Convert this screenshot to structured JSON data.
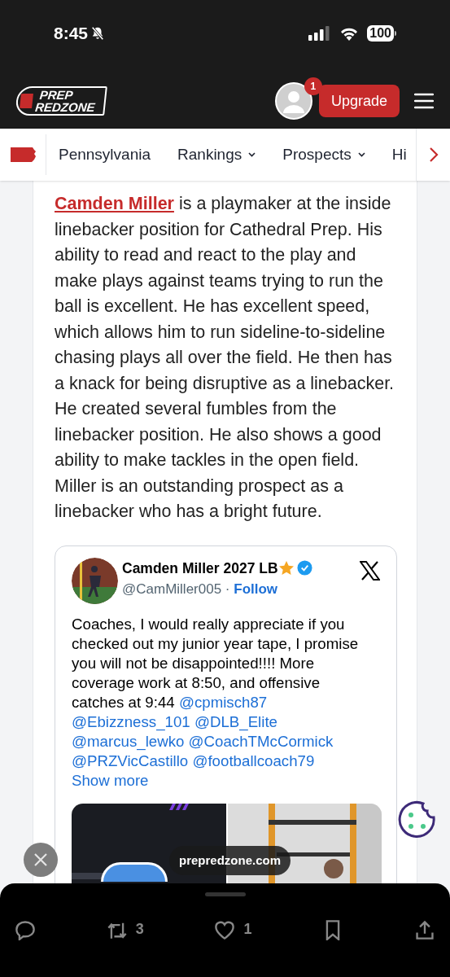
{
  "status_bar": {
    "time": "8:45",
    "battery": "100"
  },
  "header": {
    "logo_lines": [
      "PREP",
      "REDZONE"
    ],
    "notification_count": "1",
    "upgrade_button": "Upgrade"
  },
  "nav": {
    "items": [
      {
        "label": "Pennsylvania",
        "dropdown": false
      },
      {
        "label": "Rankings",
        "dropdown": true
      },
      {
        "label": "Prospects",
        "dropdown": true
      },
      {
        "label": "Hi",
        "dropdown": false
      }
    ]
  },
  "article": {
    "player_link": "Camden Miller",
    "text": " is a playmaker at the inside linebacker position for Cathedral Prep. His ability to read and react to the play and make plays against teams trying to run the ball is excellent. He has excellent speed, which allows him to run sideline-to-sideline chasing plays all over the field. He then has a knack for being disruptive as a linebacker. He created several fumbles from the linebacker position. He also shows a good ability to make tackles in the open field. Miller is an outstanding prospect as a linebacker who has a bright future."
  },
  "tweet": {
    "name": "Camden Miller 2027 LB",
    "handle": "@CamMiller005",
    "separator": "·",
    "follow": "Follow",
    "body": [
      {
        "kind": "text",
        "text": "Coaches, I would really appreciate if you checked out my junior year tape, I promise you will not be disappointed!!!! More coverage work at 8:50, and offensive catches at 9:44"
      },
      {
        "kind": "mention",
        "text": "@cpmisch87"
      },
      {
        "kind": "mention",
        "text": "@Ebizzness_101"
      },
      {
        "kind": "mention",
        "text": "@DLB_Elite"
      },
      {
        "kind": "mention",
        "text": "@marcus_lewko"
      },
      {
        "kind": "mention",
        "text": "@CoachTMcCormick"
      },
      {
        "kind": "mention",
        "text": "@PRZVicCastillo"
      },
      {
        "kind": "mention",
        "text": "@footballcoach79"
      }
    ],
    "show_more": "Show more",
    "link_preview": "prepredzone.com"
  },
  "actions": [
    {
      "kind": "reply"
    },
    {
      "kind": "retweet",
      "count": "3"
    },
    {
      "kind": "like",
      "count": "1"
    },
    {
      "kind": "bookmark"
    },
    {
      "kind": "share"
    }
  ]
}
